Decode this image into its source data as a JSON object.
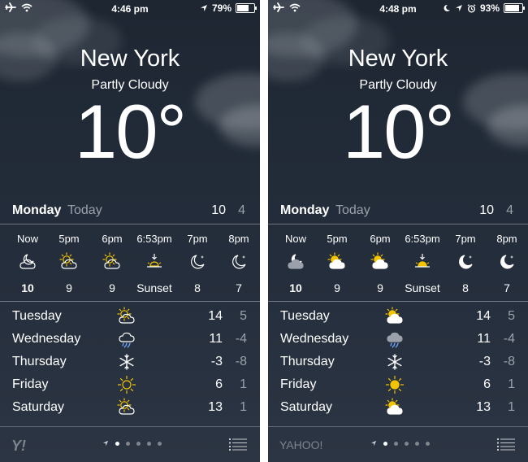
{
  "colors": {
    "sun": "#f4c400",
    "cloud_white": "#ffffff",
    "cloud_grey": "#9aa1ab",
    "muted_text": "#9aa1ab"
  },
  "screens": [
    {
      "statusbar": {
        "time": "4:46 pm",
        "battery": "79%",
        "battery_level": 0.79,
        "icons": [
          "airplane-icon",
          "wifi-icon",
          "location-arrow-icon",
          "battery-icon"
        ]
      },
      "city": "New York",
      "condition": "Partly Cloudy",
      "temperature": "10°",
      "today": {
        "day": "Monday",
        "label": "Today",
        "high": "10",
        "low": "4"
      },
      "hourly": [
        {
          "time": "Now",
          "icon": "partly-cloudy-night-icon",
          "temp": "10"
        },
        {
          "time": "5pm",
          "icon": "partly-cloudy-day-icon",
          "temp": "9"
        },
        {
          "time": "6pm",
          "icon": "partly-cloudy-day-icon",
          "temp": "9"
        },
        {
          "time": "6:53pm",
          "icon": "sunset-icon",
          "temp": "Sunset"
        },
        {
          "time": "7pm",
          "icon": "moon-icon",
          "temp": "8"
        },
        {
          "time": "8pm",
          "icon": "moon-icon",
          "temp": "7"
        }
      ],
      "daily": [
        {
          "day": "Tuesday",
          "icon": "partly-cloudy-day-icon",
          "high": "14",
          "low": "5"
        },
        {
          "day": "Wednesday",
          "icon": "rain-icon",
          "high": "11",
          "low": "-4"
        },
        {
          "day": "Thursday",
          "icon": "snow-icon",
          "high": "-3",
          "low": "-8"
        },
        {
          "day": "Friday",
          "icon": "sunny-icon",
          "high": "6",
          "low": "1"
        },
        {
          "day": "Saturday",
          "icon": "partly-cloudy-day-icon",
          "high": "13",
          "low": "1"
        }
      ],
      "bottom": {
        "logo": "Y!",
        "page_count": 5,
        "active_page": 0
      }
    },
    {
      "statusbar": {
        "time": "4:48 pm",
        "battery": "93%",
        "battery_level": 0.93,
        "icons": [
          "airplane-icon",
          "wifi-icon",
          "do-not-disturb-moon-icon",
          "location-arrow-icon",
          "alarm-clock-icon",
          "battery-icon"
        ]
      },
      "city": "New York",
      "condition": "Partly Cloudy",
      "temperature": "10°",
      "today": {
        "day": "Monday",
        "label": "Today",
        "high": "10",
        "low": "4"
      },
      "hourly": [
        {
          "time": "Now",
          "icon": "partly-cloudy-night-icon",
          "temp": "10"
        },
        {
          "time": "5pm",
          "icon": "partly-cloudy-day-icon",
          "temp": "9"
        },
        {
          "time": "6pm",
          "icon": "partly-cloudy-day-icon",
          "temp": "9"
        },
        {
          "time": "6:53pm",
          "icon": "sunset-icon",
          "temp": "Sunset"
        },
        {
          "time": "7pm",
          "icon": "moon-icon",
          "temp": "8"
        },
        {
          "time": "8pm",
          "icon": "moon-icon",
          "temp": "7"
        }
      ],
      "daily": [
        {
          "day": "Tuesday",
          "icon": "partly-cloudy-day-icon",
          "high": "14",
          "low": "5"
        },
        {
          "day": "Wednesday",
          "icon": "rain-icon",
          "high": "11",
          "low": "-4"
        },
        {
          "day": "Thursday",
          "icon": "snow-icon",
          "high": "-3",
          "low": "-8"
        },
        {
          "day": "Friday",
          "icon": "sunny-icon",
          "high": "6",
          "low": "1"
        },
        {
          "day": "Saturday",
          "icon": "partly-cloudy-day-icon",
          "high": "13",
          "low": "1"
        }
      ],
      "bottom": {
        "logo": "YAHOO!",
        "page_count": 5,
        "active_page": 0
      }
    }
  ]
}
